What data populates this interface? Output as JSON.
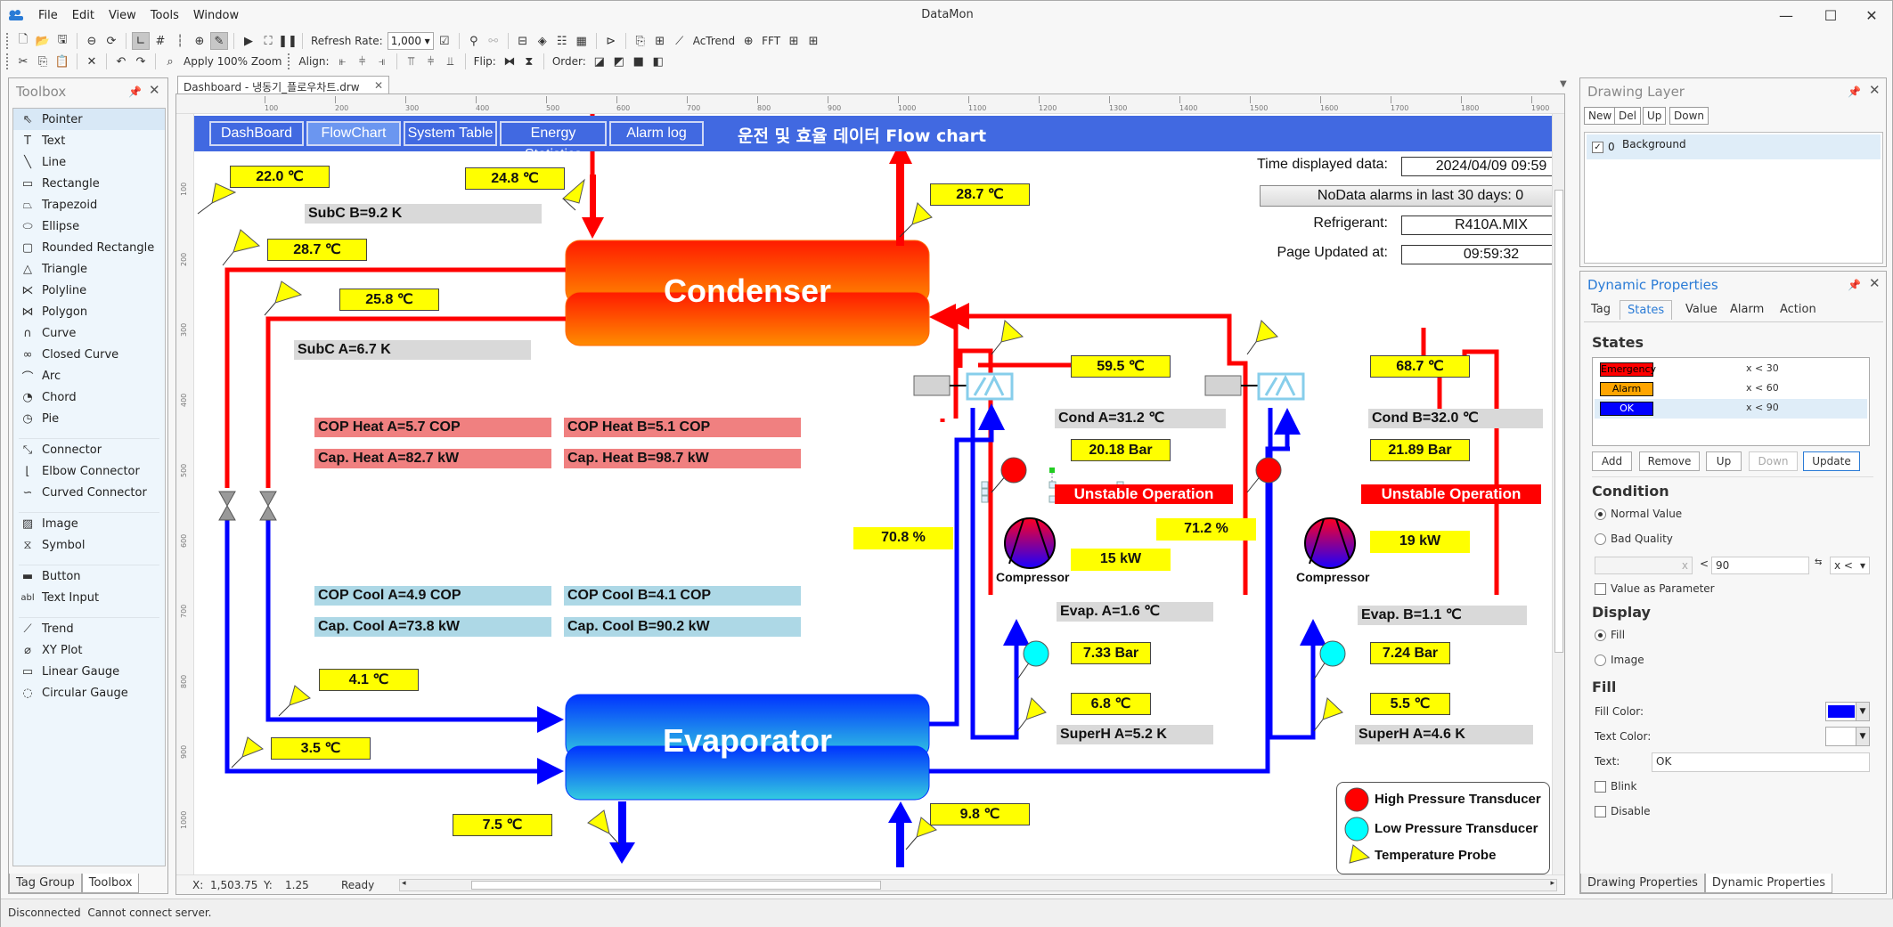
{
  "window": {
    "title": "DataMon",
    "menu": [
      "File",
      "Edit",
      "View",
      "Tools",
      "Window"
    ],
    "controls": {
      "minimize": "—",
      "maximize": "☐",
      "close": "✕"
    }
  },
  "toolbar": {
    "refresh_rate_label": "Refresh Rate:",
    "refresh_rate_value": "1,000",
    "actrend_label": "AcTrend",
    "fft_label": "FFT",
    "apply_zoom_label": "Apply 100% Zoom",
    "align_label": "Align:",
    "flip_label": "Flip:",
    "order_label": "Order:"
  },
  "toolbox": {
    "title": "Toolbox",
    "groups": [
      [
        {
          "label": "Pointer",
          "icon": "pointer-icon",
          "glyph": "⇖",
          "selected": true
        },
        {
          "label": "Text",
          "icon": "text-icon",
          "glyph": "T"
        },
        {
          "label": "Line",
          "icon": "line-icon",
          "glyph": "╲"
        },
        {
          "label": "Rectangle",
          "icon": "rectangle-icon",
          "glyph": "▭"
        },
        {
          "label": "Trapezoid",
          "icon": "trapezoid-icon",
          "glyph": "⏢"
        },
        {
          "label": "Ellipse",
          "icon": "ellipse-icon",
          "glyph": "⬭"
        },
        {
          "label": "Rounded Rectangle",
          "icon": "rounded-rectangle-icon",
          "glyph": "▢"
        },
        {
          "label": "Triangle",
          "icon": "triangle-icon",
          "glyph": "△"
        },
        {
          "label": "Polyline",
          "icon": "polyline-icon",
          "glyph": "⋉"
        },
        {
          "label": "Polygon",
          "icon": "polygon-icon",
          "glyph": "⋈"
        },
        {
          "label": "Curve",
          "icon": "curve-icon",
          "glyph": "∩"
        },
        {
          "label": "Closed Curve",
          "icon": "closed-curve-icon",
          "glyph": "∞"
        },
        {
          "label": "Arc",
          "icon": "arc-icon",
          "glyph": "⌒"
        },
        {
          "label": "Chord",
          "icon": "chord-icon",
          "glyph": "◔"
        },
        {
          "label": "Pie",
          "icon": "pie-icon",
          "glyph": "◷"
        }
      ],
      [
        {
          "label": "Connector",
          "icon": "connector-icon",
          "glyph": "⤡"
        },
        {
          "label": "Elbow Connector",
          "icon": "elbow-connector-icon",
          "glyph": "⌊"
        },
        {
          "label": "Curved Connector",
          "icon": "curved-connector-icon",
          "glyph": "∽"
        }
      ],
      [
        {
          "label": "Image",
          "icon": "image-icon",
          "glyph": "▨"
        },
        {
          "label": "Symbol",
          "icon": "symbol-icon",
          "glyph": "⧖"
        }
      ],
      [
        {
          "label": "Button",
          "icon": "button-icon",
          "glyph": "▬"
        },
        {
          "label": "Text Input",
          "icon": "text-input-icon",
          "glyph": "abl"
        }
      ],
      [
        {
          "label": "Trend",
          "icon": "trend-icon",
          "glyph": "⟋"
        },
        {
          "label": "XY Plot",
          "icon": "xy-plot-icon",
          "glyph": "⌀"
        },
        {
          "label": "Linear Gauge",
          "icon": "linear-gauge-icon",
          "glyph": "▭"
        },
        {
          "label": "Circular Gauge",
          "icon": "circular-gauge-icon",
          "glyph": "◌"
        }
      ]
    ],
    "bottom_tabs": [
      "Tag Group",
      "Toolbox"
    ]
  },
  "document": {
    "tab_title": "Dashboard - 냉동기_플로우차트.drw",
    "ruler_top": [
      "100",
      "200",
      "300",
      "400",
      "500",
      "600",
      "700",
      "800",
      "900",
      "1000",
      "1100",
      "1200",
      "1300",
      "1400",
      "1500",
      "1600",
      "1700",
      "1800",
      "1900"
    ],
    "ruler_left": [
      "100",
      "200",
      "300",
      "400",
      "500",
      "600",
      "700",
      "800",
      "900",
      "1000"
    ],
    "status": {
      "x_label": "X:",
      "x_value": "1,503.75",
      "y_label": "Y:",
      "y_value": "1.25",
      "state": "Ready"
    }
  },
  "flowchart": {
    "nav": [
      {
        "label": "DashBoard",
        "active": false
      },
      {
        "label": "FlowChart",
        "active": true
      },
      {
        "label": "System Table",
        "active": false
      },
      {
        "label": "Energy Statistics",
        "active": false
      },
      {
        "label": "Alarm log",
        "active": false
      }
    ],
    "title": "운전 및 효율 데이터 Flow chart",
    "info": {
      "time_label": "Time displayed data:",
      "time_value": "2024/04/09 09:59",
      "nodata_button": "NoData alarms in last 30 days: 0",
      "refrigerant_label": "Refrigerant:",
      "refrigerant_value": "R410A.MIX",
      "updated_label": "Page Updated at:",
      "updated_value": "09:59:32"
    },
    "condenser_label": "Condenser",
    "evaporator_label": "Evaporator",
    "compressor_label": "Compressor",
    "temps": {
      "cond_water_in_left": "22.0 ℃",
      "cond_water_in": "24.8 ℃",
      "cond_water_out": "28.7 ℃",
      "liquid_b": "28.7 ℃",
      "liquid_a": "25.8 ℃",
      "evap_in_a": "4.1 ℃",
      "evap_in_b": "3.5 ℃",
      "chilled_out": "7.5 ℃",
      "chilled_in": "9.8 ℃",
      "discharge_a": "59.5 ℃",
      "discharge_b": "68.7 ℃",
      "suction_a": "6.8 ℃",
      "suction_b": "5.5 ℃"
    },
    "pressures": {
      "high_a": "20.18 Bar",
      "high_b": "21.89 Bar",
      "low_a": "7.33 Bar",
      "low_b": "7.24 Bar"
    },
    "percent": {
      "valve_a": "70.8 %",
      "comp_a_load": "71.2 %"
    },
    "power": {
      "comp_a": "15 kW",
      "comp_b": "19 kW"
    },
    "gray_labels": {
      "subc_b": "SubC B=9.2 K",
      "subc_a": "SubC A=6.7 K",
      "cond_a": "Cond A=31.2 ℃",
      "cond_b": "Cond B=32.0 ℃",
      "evap_a": "Evap. A=1.6 ℃",
      "evap_b": "Evap. B=1.1 ℃",
      "superh_a": "SuperH A=5.2 K",
      "superh_b": "SuperH A=4.6 K"
    },
    "heat_labels": {
      "cop_a": "COP Heat A=5.7 COP",
      "cop_b": "COP Heat B=5.1 COP",
      "cap_a": "Cap. Heat A=82.7 kW",
      "cap_b": "Cap. Heat B=98.7 kW"
    },
    "cool_labels": {
      "cop_a": "COP Cool A=4.9 COP",
      "cop_b": "COP Cool B=4.1 COP",
      "cap_a": "Cap. Cool A=73.8 kW",
      "cap_b": "Cap. Cool B=90.2 kW"
    },
    "alarms": {
      "a": "Unstable Operation",
      "b": "Unstable Operation"
    },
    "legend": {
      "high": "High Pressure Transducer",
      "low": "Low Pressure Transducer",
      "temp": "Temperature Probe"
    },
    "colors": {
      "header": "#4169e1",
      "hot_line": "#ff0000",
      "cold_line": "#0000ff",
      "value_bg": "#ffff00",
      "alarm": "#ff0000"
    }
  },
  "drawing_layer": {
    "title": "Drawing Layer",
    "buttons": [
      "New",
      "Del",
      "Up",
      "Down"
    ],
    "layers": [
      {
        "index": "0",
        "name": "Background",
        "checked": true
      }
    ]
  },
  "dynamic_properties": {
    "title": "Dynamic Properties",
    "tabs": [
      "Tag",
      "States",
      "Value",
      "Alarm",
      "Action"
    ],
    "active_tab": "States",
    "states_heading": "States",
    "states": [
      {
        "name": "Emergency",
        "condition": "x < 30",
        "fill": "#ff0000",
        "text": "#000000"
      },
      {
        "name": "Alarm",
        "condition": "x < 60",
        "fill": "#ffa500",
        "text": "#000000"
      },
      {
        "name": "OK",
        "condition": "x < 90",
        "fill": "#0000ff",
        "text": "#ffffff",
        "selected": true
      }
    ],
    "state_buttons": [
      "Add",
      "Remove",
      "Up",
      "Down",
      "Update"
    ],
    "condition_heading": "Condition",
    "condition_options": [
      "Normal Value",
      "Bad Quality"
    ],
    "condition_selected": "Normal Value",
    "cond_low_placeholder": "x",
    "cond_op": "<",
    "cond_high_value": "90",
    "cond_select": "x <",
    "value_as_parameter": "Value as Parameter",
    "display_heading": "Display",
    "display_options": [
      "Fill",
      "Image"
    ],
    "display_selected": "Fill",
    "fill_heading": "Fill",
    "fill_color_label": "Fill Color:",
    "fill_color": "#0000ff",
    "text_color_label": "Text Color:",
    "text_color": "#ffffff",
    "text_label": "Text:",
    "text_value": "OK",
    "blink_label": "Blink",
    "disable_label": "Disable",
    "bottom_tabs": [
      "Drawing Properties",
      "Dynamic Properties"
    ]
  },
  "statusbar": {
    "connection": "Disconnected",
    "message": "Cannot connect server."
  }
}
